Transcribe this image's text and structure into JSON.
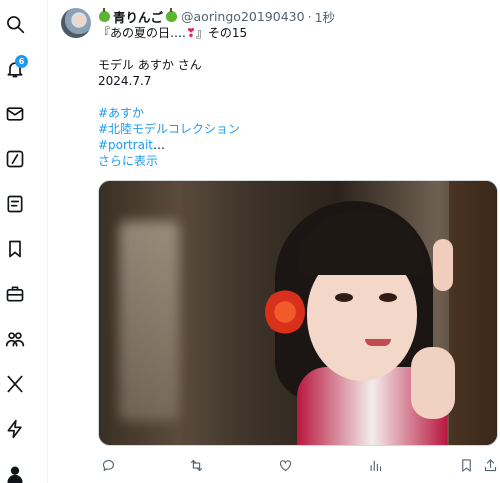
{
  "sidebar": {
    "items": [
      {
        "name": "search",
        "icon": "search-icon"
      },
      {
        "name": "notifications",
        "icon": "bell-icon",
        "badge": "6"
      },
      {
        "name": "messages",
        "icon": "mail-icon"
      },
      {
        "name": "grok",
        "icon": "slash-square-icon"
      },
      {
        "name": "lists",
        "icon": "list-icon"
      },
      {
        "name": "bookmarks",
        "icon": "bookmark-icon"
      },
      {
        "name": "jobs",
        "icon": "briefcase-icon"
      },
      {
        "name": "communities",
        "icon": "people-icon"
      },
      {
        "name": "premium",
        "icon": "x-logo-icon"
      },
      {
        "name": "verified-orgs",
        "icon": "lightning-icon"
      },
      {
        "name": "profile",
        "icon": "person-icon"
      }
    ]
  },
  "tweet": {
    "display_name": "青りんご",
    "handle": "@aoringo20190430",
    "separator": "·",
    "time": "1秒",
    "text_line1_a": "『あの夏の日….",
    "text_line1_b": "』その15",
    "text_line2": "モデル あすか さん",
    "text_line3": "2024.7.7",
    "hashtags": [
      "#あすか",
      "#北陸モデルコレクション",
      "#portrait"
    ],
    "ellipsis": "…",
    "show_more": "さらに表示"
  },
  "actions": [
    "reply-icon",
    "retweet-icon",
    "like-icon",
    "views-icon",
    "bookmark-icon",
    "share-icon"
  ],
  "colors": {
    "accent": "#1d9bf0",
    "text": "#0f1419",
    "muted": "#536471",
    "heart": "#e0245e"
  }
}
